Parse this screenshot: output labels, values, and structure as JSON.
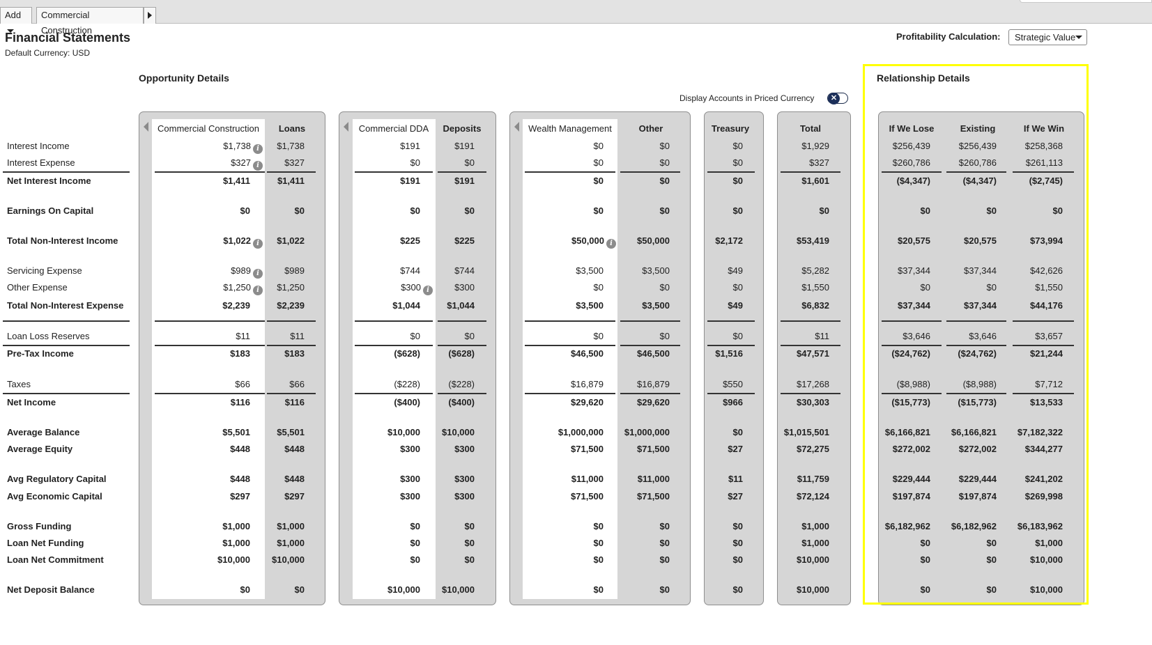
{
  "topbar": {
    "add_label": "Add",
    "tab_label": "Commercial Construction"
  },
  "header": {
    "title": "Financial Statements",
    "currency": "Default Currency: USD",
    "profit_label": "Profitability Calculation:",
    "profit_value": "Strategic Value"
  },
  "sections": {
    "opportunity": "Opportunity Details",
    "relationship": "Relationship Details"
  },
  "toggle": {
    "label": "Display Accounts in Priced Currency",
    "icon": "x-icon"
  },
  "rows": [
    {
      "label": "Interest Income",
      "bold": false
    },
    {
      "label": "Interest Expense",
      "bold": false
    },
    {
      "label": "Net Interest Income",
      "bold": true
    },
    {
      "label": "Earnings On Capital",
      "bold": true
    },
    {
      "label": "Total Non-Interest Income",
      "bold": true
    },
    {
      "label": "Servicing Expense",
      "bold": false
    },
    {
      "label": "Other Expense",
      "bold": false
    },
    {
      "label": "Total Non-Interest Expense",
      "bold": true
    },
    {
      "label": "Loan Loss Reserves",
      "bold": false
    },
    {
      "label": "Pre-Tax Income",
      "bold": true
    },
    {
      "label": "Taxes",
      "bold": false
    },
    {
      "label": "Net Income",
      "bold": true
    },
    {
      "label": "Average Balance",
      "bold": true
    },
    {
      "label": "Average Equity",
      "bold": true
    },
    {
      "label": "Avg Regulatory Capital",
      "bold": true
    },
    {
      "label": "Avg Economic Capital",
      "bold": true
    },
    {
      "label": "Gross Funding",
      "bold": true
    },
    {
      "label": "Loan Net Funding",
      "bold": true
    },
    {
      "label": "Loan Net Commitment",
      "bold": true
    },
    {
      "label": "Net Deposit Balance",
      "bold": true
    }
  ],
  "columns": [
    {
      "header": "Commercial Construction",
      "header_bold": false,
      "values": [
        "$1,738",
        "$327",
        "$1,411",
        "$0",
        "$1,022",
        "$989",
        "$1,250",
        "$2,239",
        "$11",
        "$183",
        "$66",
        "$116",
        "$5,501",
        "$448",
        "$448",
        "$297",
        "$1,000",
        "$1,000",
        "$10,000",
        "$0"
      ],
      "info": [
        0,
        1,
        4,
        5,
        6
      ]
    },
    {
      "header": "Loans",
      "header_bold": true,
      "values": [
        "$1,738",
        "$327",
        "$1,411",
        "$0",
        "$1,022",
        "$989",
        "$1,250",
        "$2,239",
        "$11",
        "$183",
        "$66",
        "$116",
        "$5,501",
        "$448",
        "$448",
        "$297",
        "$1,000",
        "$1,000",
        "$10,000",
        "$0"
      ],
      "info": []
    },
    {
      "header": "Commercial DDA",
      "header_bold": false,
      "values": [
        "$191",
        "$0",
        "$191",
        "$0",
        "$225",
        "$744",
        "$300",
        "$1,044",
        "$0",
        "($628)",
        "($228)",
        "($400)",
        "$10,000",
        "$300",
        "$300",
        "$300",
        "$0",
        "$0",
        "$0",
        "$10,000"
      ],
      "info": [
        6
      ]
    },
    {
      "header": "Deposits",
      "header_bold": true,
      "values": [
        "$191",
        "$0",
        "$191",
        "$0",
        "$225",
        "$744",
        "$300",
        "$1,044",
        "$0",
        "($628)",
        "($228)",
        "($400)",
        "$10,000",
        "$300",
        "$300",
        "$300",
        "$0",
        "$0",
        "$0",
        "$10,000"
      ],
      "info": []
    },
    {
      "header": "Wealth Management",
      "header_bold": false,
      "values": [
        "$0",
        "$0",
        "$0",
        "$0",
        "$50,000",
        "$3,500",
        "$0",
        "$3,500",
        "$0",
        "$46,500",
        "$16,879",
        "$29,620",
        "$1,000,000",
        "$71,500",
        "$11,000",
        "$71,500",
        "$0",
        "$0",
        "$0",
        "$0"
      ],
      "info": [
        4
      ]
    },
    {
      "header": "Other",
      "header_bold": true,
      "values": [
        "$0",
        "$0",
        "$0",
        "$0",
        "$50,000",
        "$3,500",
        "$0",
        "$3,500",
        "$0",
        "$46,500",
        "$16,879",
        "$29,620",
        "$1,000,000",
        "$71,500",
        "$11,000",
        "$71,500",
        "$0",
        "$0",
        "$0",
        "$0"
      ],
      "info": []
    },
    {
      "header": "Treasury",
      "header_bold": true,
      "values": [
        "$0",
        "$0",
        "$0",
        "$0",
        "$2,172",
        "$49",
        "$0",
        "$49",
        "$0",
        "$1,516",
        "$550",
        "$966",
        "$0",
        "$27",
        "$11",
        "$27",
        "$0",
        "$0",
        "$0",
        "$0"
      ],
      "info": []
    },
    {
      "header": "Total",
      "header_bold": true,
      "values": [
        "$1,929",
        "$327",
        "$1,601",
        "$0",
        "$53,419",
        "$5,282",
        "$1,550",
        "$6,832",
        "$11",
        "$47,571",
        "$17,268",
        "$30,303",
        "$1,015,501",
        "$72,275",
        "$11,759",
        "$72,124",
        "$1,000",
        "$1,000",
        "$10,000",
        "$10,000"
      ],
      "info": []
    },
    {
      "header": "If We Lose",
      "header_bold": true,
      "values": [
        "$256,439",
        "$260,786",
        "($4,347)",
        "$0",
        "$20,575",
        "$37,344",
        "$0",
        "$37,344",
        "$3,646",
        "($24,762)",
        "($8,988)",
        "($15,773)",
        "$6,166,821",
        "$272,002",
        "$229,444",
        "$197,874",
        "$6,182,962",
        "$0",
        "$0",
        "$0"
      ],
      "info": []
    },
    {
      "header": "Existing",
      "header_bold": true,
      "values": [
        "$256,439",
        "$260,786",
        "($4,347)",
        "$0",
        "$20,575",
        "$37,344",
        "$0",
        "$37,344",
        "$3,646",
        "($24,762)",
        "($8,988)",
        "($15,773)",
        "$6,166,821",
        "$272,002",
        "$229,444",
        "$197,874",
        "$6,182,962",
        "$0",
        "$0",
        "$0"
      ],
      "info": []
    },
    {
      "header": "If We Win",
      "header_bold": true,
      "values": [
        "$258,368",
        "$261,113",
        "($2,745)",
        "$0",
        "$73,994",
        "$42,626",
        "$1,550",
        "$44,176",
        "$3,657",
        "$21,244",
        "$7,712",
        "$13,533",
        "$7,182,322",
        "$344,277",
        "$241,202",
        "$269,998",
        "$6,183,962",
        "$1,000",
        "$10,000",
        "$10,000"
      ],
      "info": []
    }
  ]
}
